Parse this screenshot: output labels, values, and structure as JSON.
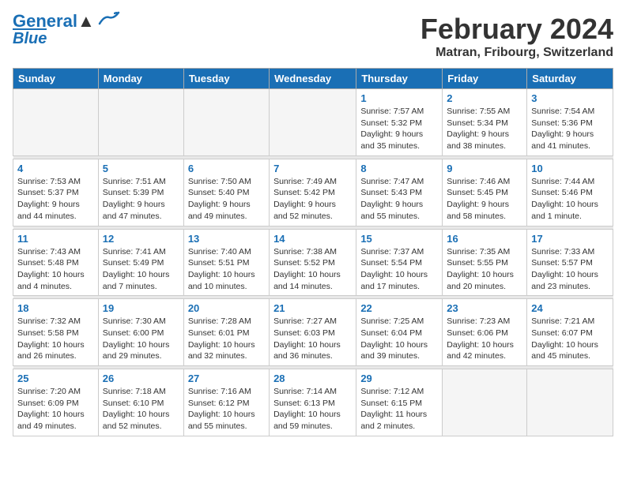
{
  "header": {
    "logo_line1": "General",
    "logo_line2": "Blue",
    "month": "February 2024",
    "location": "Matran, Fribourg, Switzerland"
  },
  "days_of_week": [
    "Sunday",
    "Monday",
    "Tuesday",
    "Wednesday",
    "Thursday",
    "Friday",
    "Saturday"
  ],
  "weeks": [
    {
      "days": [
        {
          "num": "",
          "info": ""
        },
        {
          "num": "",
          "info": ""
        },
        {
          "num": "",
          "info": ""
        },
        {
          "num": "",
          "info": ""
        },
        {
          "num": "1",
          "info": "Sunrise: 7:57 AM\nSunset: 5:32 PM\nDaylight: 9 hours\nand 35 minutes."
        },
        {
          "num": "2",
          "info": "Sunrise: 7:55 AM\nSunset: 5:34 PM\nDaylight: 9 hours\nand 38 minutes."
        },
        {
          "num": "3",
          "info": "Sunrise: 7:54 AM\nSunset: 5:36 PM\nDaylight: 9 hours\nand 41 minutes."
        }
      ]
    },
    {
      "days": [
        {
          "num": "4",
          "info": "Sunrise: 7:53 AM\nSunset: 5:37 PM\nDaylight: 9 hours\nand 44 minutes."
        },
        {
          "num": "5",
          "info": "Sunrise: 7:51 AM\nSunset: 5:39 PM\nDaylight: 9 hours\nand 47 minutes."
        },
        {
          "num": "6",
          "info": "Sunrise: 7:50 AM\nSunset: 5:40 PM\nDaylight: 9 hours\nand 49 minutes."
        },
        {
          "num": "7",
          "info": "Sunrise: 7:49 AM\nSunset: 5:42 PM\nDaylight: 9 hours\nand 52 minutes."
        },
        {
          "num": "8",
          "info": "Sunrise: 7:47 AM\nSunset: 5:43 PM\nDaylight: 9 hours\nand 55 minutes."
        },
        {
          "num": "9",
          "info": "Sunrise: 7:46 AM\nSunset: 5:45 PM\nDaylight: 9 hours\nand 58 minutes."
        },
        {
          "num": "10",
          "info": "Sunrise: 7:44 AM\nSunset: 5:46 PM\nDaylight: 10 hours\nand 1 minute."
        }
      ]
    },
    {
      "days": [
        {
          "num": "11",
          "info": "Sunrise: 7:43 AM\nSunset: 5:48 PM\nDaylight: 10 hours\nand 4 minutes."
        },
        {
          "num": "12",
          "info": "Sunrise: 7:41 AM\nSunset: 5:49 PM\nDaylight: 10 hours\nand 7 minutes."
        },
        {
          "num": "13",
          "info": "Sunrise: 7:40 AM\nSunset: 5:51 PM\nDaylight: 10 hours\nand 10 minutes."
        },
        {
          "num": "14",
          "info": "Sunrise: 7:38 AM\nSunset: 5:52 PM\nDaylight: 10 hours\nand 14 minutes."
        },
        {
          "num": "15",
          "info": "Sunrise: 7:37 AM\nSunset: 5:54 PM\nDaylight: 10 hours\nand 17 minutes."
        },
        {
          "num": "16",
          "info": "Sunrise: 7:35 AM\nSunset: 5:55 PM\nDaylight: 10 hours\nand 20 minutes."
        },
        {
          "num": "17",
          "info": "Sunrise: 7:33 AM\nSunset: 5:57 PM\nDaylight: 10 hours\nand 23 minutes."
        }
      ]
    },
    {
      "days": [
        {
          "num": "18",
          "info": "Sunrise: 7:32 AM\nSunset: 5:58 PM\nDaylight: 10 hours\nand 26 minutes."
        },
        {
          "num": "19",
          "info": "Sunrise: 7:30 AM\nSunset: 6:00 PM\nDaylight: 10 hours\nand 29 minutes."
        },
        {
          "num": "20",
          "info": "Sunrise: 7:28 AM\nSunset: 6:01 PM\nDaylight: 10 hours\nand 32 minutes."
        },
        {
          "num": "21",
          "info": "Sunrise: 7:27 AM\nSunset: 6:03 PM\nDaylight: 10 hours\nand 36 minutes."
        },
        {
          "num": "22",
          "info": "Sunrise: 7:25 AM\nSunset: 6:04 PM\nDaylight: 10 hours\nand 39 minutes."
        },
        {
          "num": "23",
          "info": "Sunrise: 7:23 AM\nSunset: 6:06 PM\nDaylight: 10 hours\nand 42 minutes."
        },
        {
          "num": "24",
          "info": "Sunrise: 7:21 AM\nSunset: 6:07 PM\nDaylight: 10 hours\nand 45 minutes."
        }
      ]
    },
    {
      "days": [
        {
          "num": "25",
          "info": "Sunrise: 7:20 AM\nSunset: 6:09 PM\nDaylight: 10 hours\nand 49 minutes."
        },
        {
          "num": "26",
          "info": "Sunrise: 7:18 AM\nSunset: 6:10 PM\nDaylight: 10 hours\nand 52 minutes."
        },
        {
          "num": "27",
          "info": "Sunrise: 7:16 AM\nSunset: 6:12 PM\nDaylight: 10 hours\nand 55 minutes."
        },
        {
          "num": "28",
          "info": "Sunrise: 7:14 AM\nSunset: 6:13 PM\nDaylight: 10 hours\nand 59 minutes."
        },
        {
          "num": "29",
          "info": "Sunrise: 7:12 AM\nSunset: 6:15 PM\nDaylight: 11 hours\nand 2 minutes."
        },
        {
          "num": "",
          "info": ""
        },
        {
          "num": "",
          "info": ""
        }
      ]
    }
  ]
}
